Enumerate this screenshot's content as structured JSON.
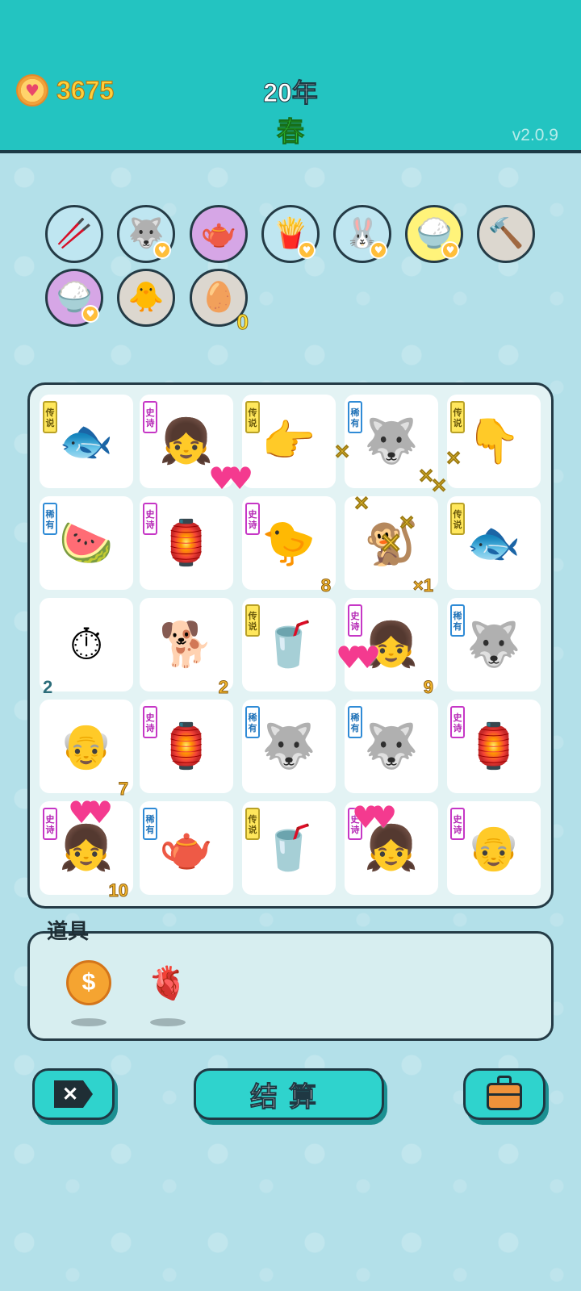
{
  "header": {
    "coins": "3675",
    "year": "20年",
    "season": "春",
    "version": "v2.0.9"
  },
  "items_bar": [
    {
      "name": "chopsticks",
      "glyph": "🥢",
      "bg": "#bfe6f1",
      "badge": false
    },
    {
      "name": "husky",
      "glyph": "🐺",
      "bg": "#bfe6f1",
      "badge": true
    },
    {
      "name": "gravy-boat",
      "glyph": "🫖",
      "bg": "#d6a6e6",
      "badge": false
    },
    {
      "name": "fries",
      "glyph": "🍟",
      "bg": "#bfe6f1",
      "badge": true
    },
    {
      "name": "rabbit",
      "glyph": "🐰",
      "bg": "#bfe6f1",
      "badge": true
    },
    {
      "name": "rice-bowl",
      "glyph": "🍚",
      "bg": "#fff37a",
      "badge": true
    },
    {
      "name": "hammer",
      "glyph": "🔨",
      "bg": "#dcd7cf",
      "badge": false
    },
    {
      "name": "rice-bowl-2",
      "glyph": "🍚",
      "bg": "#d6a6e6",
      "badge": true
    },
    {
      "name": "chick",
      "glyph": "🐥",
      "bg": "#dcd7cf",
      "badge": false
    },
    {
      "name": "egg-tray",
      "glyph": "🥚",
      "bg": "#dcd7cf",
      "badge": false,
      "count": "0"
    }
  ],
  "rarity_labels": {
    "legend": "传说",
    "epic": "史诗",
    "rare": "稀有"
  },
  "board": [
    [
      {
        "icon": "koi-fish",
        "glyph": "🐟",
        "tag": "legend"
      },
      {
        "icon": "girl-braids",
        "glyph": "👧",
        "tag": "epic"
      },
      {
        "icon": "pointing-hand",
        "glyph": "👉",
        "tag": "legend"
      },
      {
        "icon": "husky",
        "glyph": "🐺",
        "tag": "rare"
      },
      {
        "icon": "pointing-hand",
        "glyph": "👇",
        "tag": "legend"
      }
    ],
    [
      {
        "icon": "watermelon",
        "glyph": "🍉",
        "tag": "rare"
      },
      {
        "icon": "rabbit-house",
        "glyph": "🏮",
        "tag": "epic"
      },
      {
        "icon": "chick-heart-eyes",
        "glyph": "🐤",
        "tag": "epic",
        "num": "8"
      },
      {
        "icon": "monkey",
        "glyph": "🐒",
        "tag": null,
        "num": "×1"
      },
      {
        "icon": "koi-fish",
        "glyph": "🐟",
        "tag": "legend"
      }
    ],
    [
      {
        "icon": "stopwatch-card",
        "glyph": "⏱",
        "tag": null,
        "num": "2",
        "num_left": true
      },
      {
        "icon": "dog",
        "glyph": "🐕",
        "tag": null,
        "num": "2"
      },
      {
        "icon": "bubble-tea",
        "glyph": "🥤",
        "tag": "legend"
      },
      {
        "icon": "girl-braids",
        "glyph": "👧",
        "tag": "epic",
        "num": "9"
      },
      {
        "icon": "husky",
        "glyph": "🐺",
        "tag": "rare"
      }
    ],
    [
      {
        "icon": "old-man-heart-glasses",
        "glyph": "👴",
        "tag": null,
        "num": "7"
      },
      {
        "icon": "rabbit-house",
        "glyph": "🏮",
        "tag": "epic"
      },
      {
        "icon": "husky",
        "glyph": "🐺",
        "tag": "rare"
      },
      {
        "icon": "husky",
        "glyph": "🐺",
        "tag": "rare"
      },
      {
        "icon": "rabbit-house",
        "glyph": "🏮",
        "tag": "epic"
      }
    ],
    [
      {
        "icon": "girl-braids",
        "glyph": "👧",
        "tag": "epic",
        "num": "10"
      },
      {
        "icon": "teapot",
        "glyph": "🫖",
        "tag": "rare"
      },
      {
        "icon": "bubble-tea",
        "glyph": "🥤",
        "tag": "legend"
      },
      {
        "icon": "girl-braids",
        "glyph": "👧",
        "tag": "epic"
      },
      {
        "icon": "old-man-hat",
        "glyph": "👴",
        "tag": "epic"
      }
    ]
  ],
  "tools": {
    "title": "道具",
    "items": [
      {
        "name": "coin-tool",
        "glyph": "$"
      },
      {
        "name": "liver-tool",
        "glyph": "🫀"
      }
    ]
  },
  "buttons": {
    "settle": "结算"
  },
  "colors": {
    "header_bg": "#23c4c1",
    "button_bg": "#2fd3cd",
    "coin_text": "#ffcf3a",
    "season_text": "#39e23c"
  }
}
